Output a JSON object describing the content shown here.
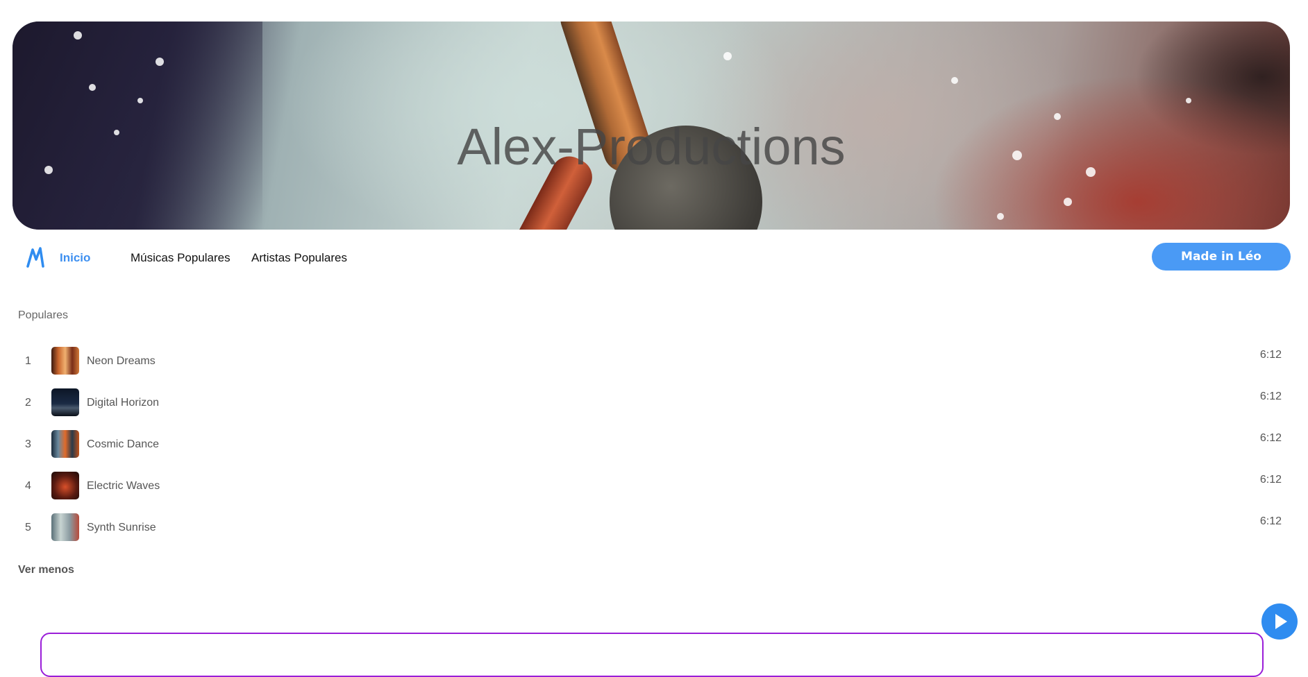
{
  "hero": {
    "title": "Alex-Productions"
  },
  "nav": {
    "logo_icon": "m-logo-icon",
    "links": [
      {
        "label": "Inicio",
        "active": true
      },
      {
        "label": "Músicas Populares",
        "active": false
      },
      {
        "label": "Artistas Populares",
        "active": false
      }
    ],
    "made_button": "Made in Léo"
  },
  "popular": {
    "title": "Populares",
    "tracks": [
      {
        "num": "1",
        "name": "Neon Dreams",
        "duration": "6:12"
      },
      {
        "num": "2",
        "name": "Digital Horizon",
        "duration": "6:12"
      },
      {
        "num": "3",
        "name": "Cosmic Dance",
        "duration": "6:12"
      },
      {
        "num": "4",
        "name": "Electric Waves",
        "duration": "6:12"
      },
      {
        "num": "5",
        "name": "Synth Sunrise",
        "duration": "6:12"
      }
    ],
    "toggle_label": "Ver menos"
  },
  "player": {
    "play_icon": "play-icon"
  },
  "colors": {
    "accent": "#4a9af5",
    "panel_border": "#9a1ed8"
  }
}
